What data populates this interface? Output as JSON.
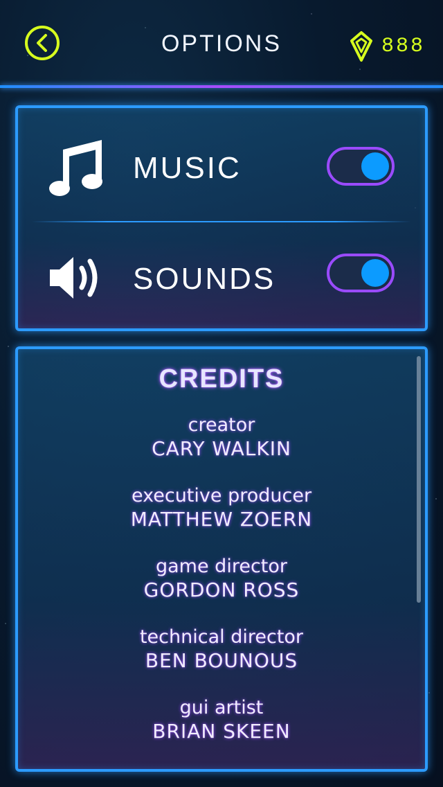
{
  "header": {
    "title": "OPTIONS",
    "currency_value": "888"
  },
  "settings": {
    "music": {
      "label": "MUSIC",
      "enabled": true
    },
    "sounds": {
      "label": "SOUNDS",
      "enabled": true
    }
  },
  "credits": {
    "title": "CREDITS",
    "entries": [
      {
        "role": "creator",
        "name": "CARY WALKIN"
      },
      {
        "role": "executive producer",
        "name": "MATTHEW ZOERN"
      },
      {
        "role": "game director",
        "name": "GORDON ROSS"
      },
      {
        "role": "technical director",
        "name": "BEN BOUNOUS"
      },
      {
        "role": "gui artist",
        "name": "BRIAN SKEEN"
      }
    ]
  },
  "colors": {
    "accent_yellow": "#d7ff1e",
    "panel_border": "#2c9bff",
    "toggle_border": "#9a4bff",
    "toggle_knob": "#0c9bff"
  },
  "icons": {
    "back": "chevron-left-icon",
    "currency": "gem-icon",
    "music": "music-note-icon",
    "sounds": "speaker-icon"
  }
}
